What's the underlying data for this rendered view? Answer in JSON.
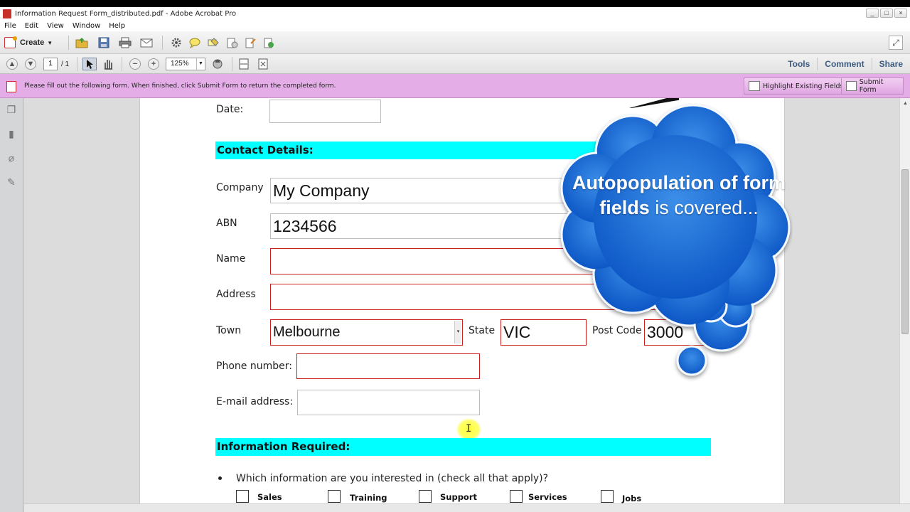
{
  "window": {
    "title": "Information Request Form_distributed.pdf - Adobe Acrobat Pro",
    "controls": [
      "_",
      "□",
      "×"
    ]
  },
  "menu": [
    "File",
    "Edit",
    "View",
    "Window",
    "Help"
  ],
  "toolbar": {
    "create_label": "Create",
    "page_current": "1",
    "page_total": "/ 1",
    "zoom": "125%",
    "right_links": [
      "Tools",
      "Comment",
      "Share"
    ]
  },
  "formbar": {
    "message": "Please fill out the following form. When finished, click Submit Form to return the completed form.",
    "highlight_label": "Highlight Existing Fields",
    "submit_label": "Submit Form"
  },
  "form": {
    "date_label": "Date:",
    "date_value": "",
    "contact_section": "Contact Details:",
    "company_label": "Company",
    "company_value": "My Company",
    "abn_label": "ABN",
    "abn_value": "1234566",
    "name_label": "Name",
    "name_value": "",
    "address_label": "Address",
    "address_value": "",
    "town_label": "Town",
    "town_value": "Melbourne",
    "state_label": "State",
    "state_value": "VIC",
    "postcode_label": "Post Code",
    "postcode_value": "3000",
    "phone_label": "Phone number:",
    "phone_value": "",
    "email_label": "E-mail address:",
    "email_value": "",
    "info_section": "Information Required:",
    "question": "Which information are you interested in (check all that apply)?",
    "checkboxes": [
      "Sales",
      "Training",
      "Support",
      "Services",
      "Jobs"
    ]
  },
  "callout": {
    "bold_text": "Autopopulation of form fields",
    "rest_text": " is covered..."
  }
}
